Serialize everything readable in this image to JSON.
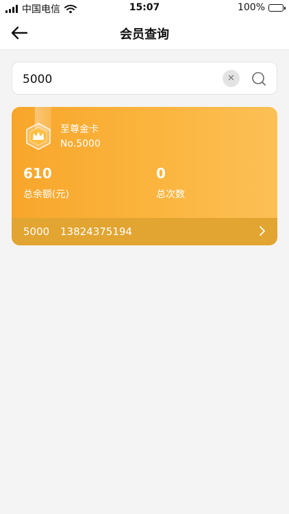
{
  "status_bar": {
    "carrier": "中国电信",
    "time": "15:07",
    "battery_percent": "100%",
    "battery_level": 1.0,
    "battery_color": "#34c759"
  },
  "header": {
    "title": "会员查询",
    "back_icon": "arrow-left-icon"
  },
  "search": {
    "value": "5000",
    "clear_icon": "clear-icon",
    "search_icon": "search-icon"
  },
  "member_card": {
    "card_name": "至尊金卡",
    "card_no": "No.5000",
    "balance_value": "610",
    "balance_label": "总余额(元)",
    "count_value": "0",
    "count_label": "总次数",
    "member_number": "5000",
    "phone": "13824375194",
    "badge_icon": "crown-badge-icon",
    "accent_color": "#f8a62b",
    "footer_color": "#e2a531"
  }
}
